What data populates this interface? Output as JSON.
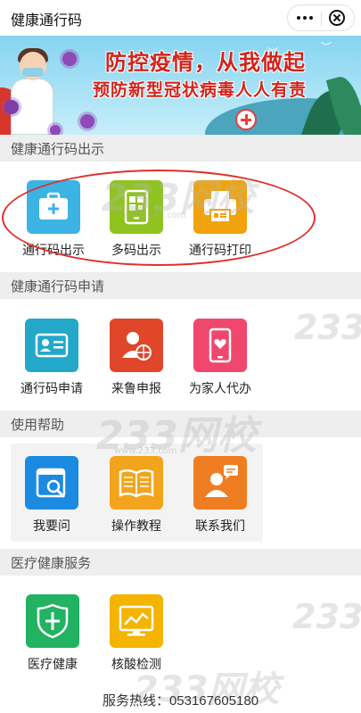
{
  "app": {
    "title": "健康通行码"
  },
  "banner": {
    "headline": "防控疫情，从我做起",
    "subline": "预防新型冠状病毒人人有责"
  },
  "sections": [
    {
      "title": "健康通行码出示",
      "items": [
        {
          "label": "通行码出示",
          "icon": "medical-kit-icon",
          "color": "#3bb3e3"
        },
        {
          "label": "多码出示",
          "icon": "qr-phone-icon",
          "color": "#8fc31f"
        },
        {
          "label": "通行码打印",
          "icon": "printer-icon",
          "color": "#f0a30a"
        }
      ]
    },
    {
      "title": "健康通行码申请",
      "items": [
        {
          "label": "通行码申请",
          "icon": "id-card-icon",
          "color": "#23a8c9"
        },
        {
          "label": "来鲁申报",
          "icon": "person-globe-icon",
          "color": "#e0462a"
        },
        {
          "label": "为家人代办",
          "icon": "phone-heart-icon",
          "color": "#f0476e"
        }
      ]
    },
    {
      "title": "使用帮助",
      "items": [
        {
          "label": "我要问",
          "icon": "calendar-search-icon",
          "color": "#1a8be0"
        },
        {
          "label": "操作教程",
          "icon": "book-icon",
          "color": "#f2a51c"
        },
        {
          "label": "联系我们",
          "icon": "customer-service-icon",
          "color": "#ef7d22"
        }
      ]
    },
    {
      "title": "医疗健康服务",
      "items": [
        {
          "label": "医疗健康",
          "icon": "health-shield-icon",
          "color": "#21b262"
        },
        {
          "label": "核酸检测",
          "icon": "monitor-chart-icon",
          "color": "#f4b400"
        }
      ]
    }
  ],
  "watermark": {
    "brand": "233网校",
    "url": "www.233.com"
  },
  "footer": {
    "hotline": "服务热线：053167605180"
  }
}
